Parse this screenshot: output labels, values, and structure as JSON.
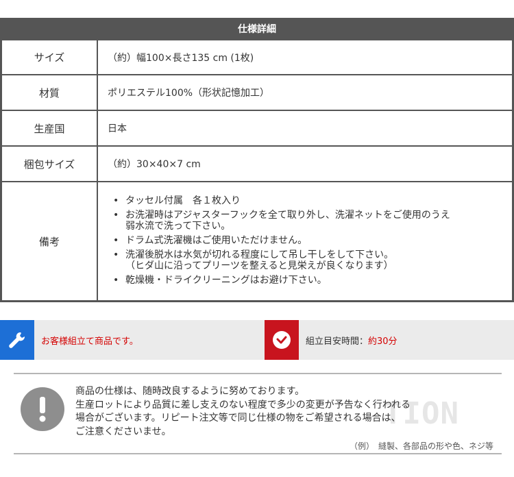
{
  "spec": {
    "title": "仕様詳細",
    "rows": [
      {
        "label": "サイズ",
        "value": "（約）幅100×長さ135 cm (1枚)"
      },
      {
        "label": "材質",
        "value": "ポリエステル100%（形状記憶加工）"
      },
      {
        "label": "生産国",
        "value": "日本"
      },
      {
        "label": "梱包サイズ",
        "value": "（約）30×40×7 cm"
      }
    ],
    "notes_label": "備考",
    "notes": [
      "タッセル付属　各１枚入り",
      "お洗濯時はアジャスターフックを全て取り外し、洗濯ネットをご使用のうえ\n弱水流で洗って下さい。",
      "ドラム式洗濯機はご使用いただけません。",
      "洗濯後脱水は水気が切れる程度にして吊し干しをして下さい。\n（ヒダ山に沿ってプリーツを整えると見栄えが良くなります）",
      "乾燥機・ドライクリーニングはお避け下さい。"
    ]
  },
  "assembly": {
    "left_text": "お客様組立て商品です。",
    "right_label": "組立目安時間：",
    "right_value": "約30分",
    "colors": {
      "wrench_bg": "#1d6fd6",
      "clock_bg": "#c8141e",
      "accent_text": "#d40000"
    },
    "icons": {
      "left": "wrench-icon",
      "right": "clock-icon"
    }
  },
  "caution": {
    "lines": [
      "商品の仕様は、随時改良するように努めております。",
      "生産ロットにより品質に差し支えのない程度で多少の変更が予告なく行われる",
      "場合がございます。リピート注文等で同じ仕様の物をご希望される場合は、",
      "ご注意くださいませ。"
    ],
    "watermark": "TION",
    "example": "（例）　縫製、各部品の形や色、ネジ等",
    "icon": "exclamation-icon"
  }
}
